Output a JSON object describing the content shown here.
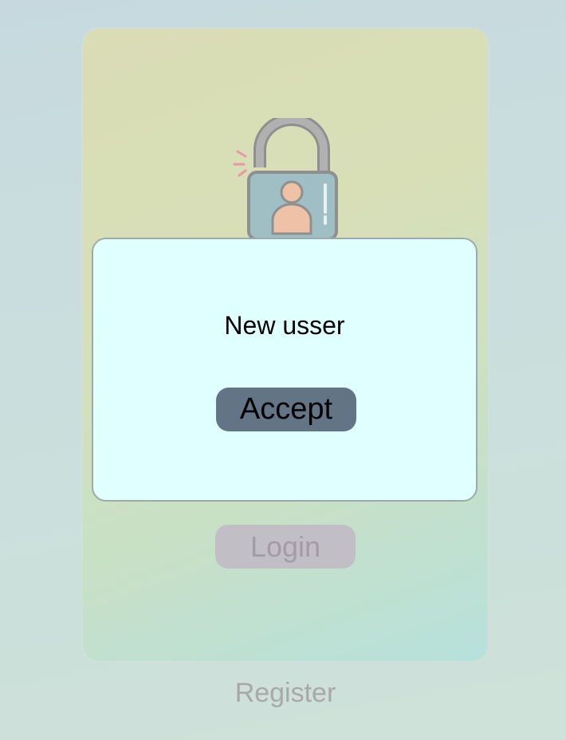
{
  "background_screen": {
    "icon": "unlocked-padlock-user-icon",
    "login_button_label": "Login",
    "register_link_label": "Register"
  },
  "dialog": {
    "message": "New usser",
    "accept_button_label": "Accept"
  },
  "colors": {
    "dialog_background": "#e0ffff",
    "accept_button": "#627486",
    "login_button_disabled": "#c2bec6",
    "register_text": "#a9a7a8"
  }
}
